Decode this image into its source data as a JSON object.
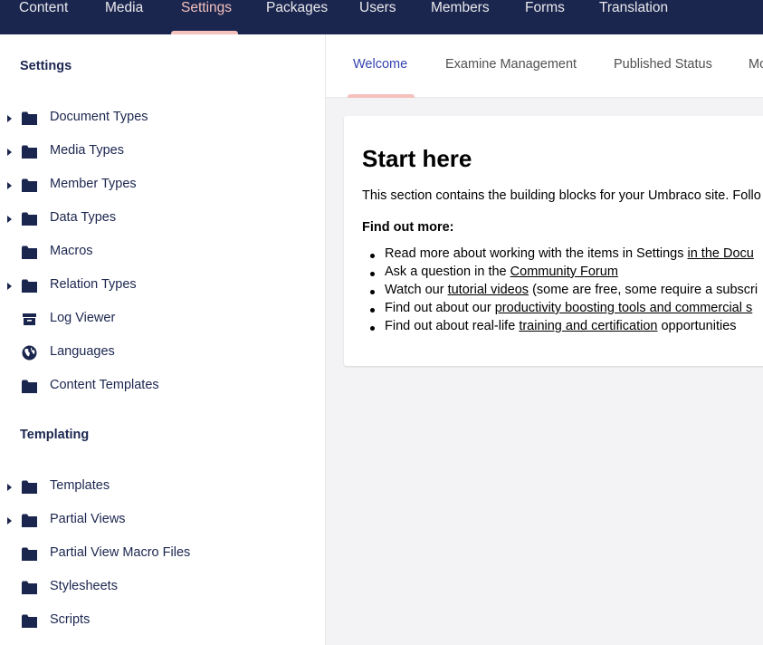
{
  "topnav": {
    "items": [
      "Content",
      "Media",
      "Settings",
      "Packages",
      "Users",
      "Members",
      "Forms",
      "Translation"
    ],
    "active": "Settings"
  },
  "sidebar": {
    "settings_title": "Settings",
    "settings_items": [
      {
        "label": "Document Types",
        "icon": "folder-icon",
        "expandable": true
      },
      {
        "label": "Media Types",
        "icon": "folder-icon",
        "expandable": true
      },
      {
        "label": "Member Types",
        "icon": "folder-icon",
        "expandable": true
      },
      {
        "label": "Data Types",
        "icon": "folder-icon",
        "expandable": true
      },
      {
        "label": "Macros",
        "icon": "folder-icon",
        "expandable": false
      },
      {
        "label": "Relation Types",
        "icon": "folder-icon",
        "expandable": true
      },
      {
        "label": "Log Viewer",
        "icon": "archive-box-icon",
        "expandable": false
      },
      {
        "label": "Languages",
        "icon": "globe-icon",
        "expandable": false
      },
      {
        "label": "Content Templates",
        "icon": "folder-icon",
        "expandable": false
      }
    ],
    "templating_title": "Templating",
    "templating_items": [
      {
        "label": "Templates",
        "icon": "folder-icon",
        "expandable": true
      },
      {
        "label": "Partial Views",
        "icon": "folder-icon",
        "expandable": true
      },
      {
        "label": "Partial View Macro Files",
        "icon": "folder-icon",
        "expandable": false
      },
      {
        "label": "Stylesheets",
        "icon": "folder-icon",
        "expandable": false
      },
      {
        "label": "Scripts",
        "icon": "folder-icon",
        "expandable": false
      }
    ]
  },
  "tabs": {
    "items": [
      "Welcome",
      "Examine Management",
      "Published Status",
      "Mo"
    ],
    "active": "Welcome"
  },
  "card": {
    "title": "Start here",
    "intro": "This section contains the building blocks for your Umbraco site. Follo",
    "find_more": "Find out more:",
    "bullets": [
      {
        "before": "Read more about working with the items in Settings ",
        "link": "in the Docu",
        "after": ""
      },
      {
        "before": "Ask a question in the ",
        "link": "Community Forum",
        "after": ""
      },
      {
        "before": "Watch our ",
        "link": "tutorial videos",
        "after": " (some are free, some require a subscri"
      },
      {
        "before": "Find out about our ",
        "link": "productivity boosting tools and commercial s",
        "after": ""
      },
      {
        "before": "Find out about real-life ",
        "link": "training and certification",
        "after": " opportunities"
      }
    ]
  },
  "colors": {
    "nav_bg": "#1b264f",
    "accent_pink": "#f5c1bc",
    "active_tab": "#3544b1",
    "text_dark": "#1b264f"
  }
}
